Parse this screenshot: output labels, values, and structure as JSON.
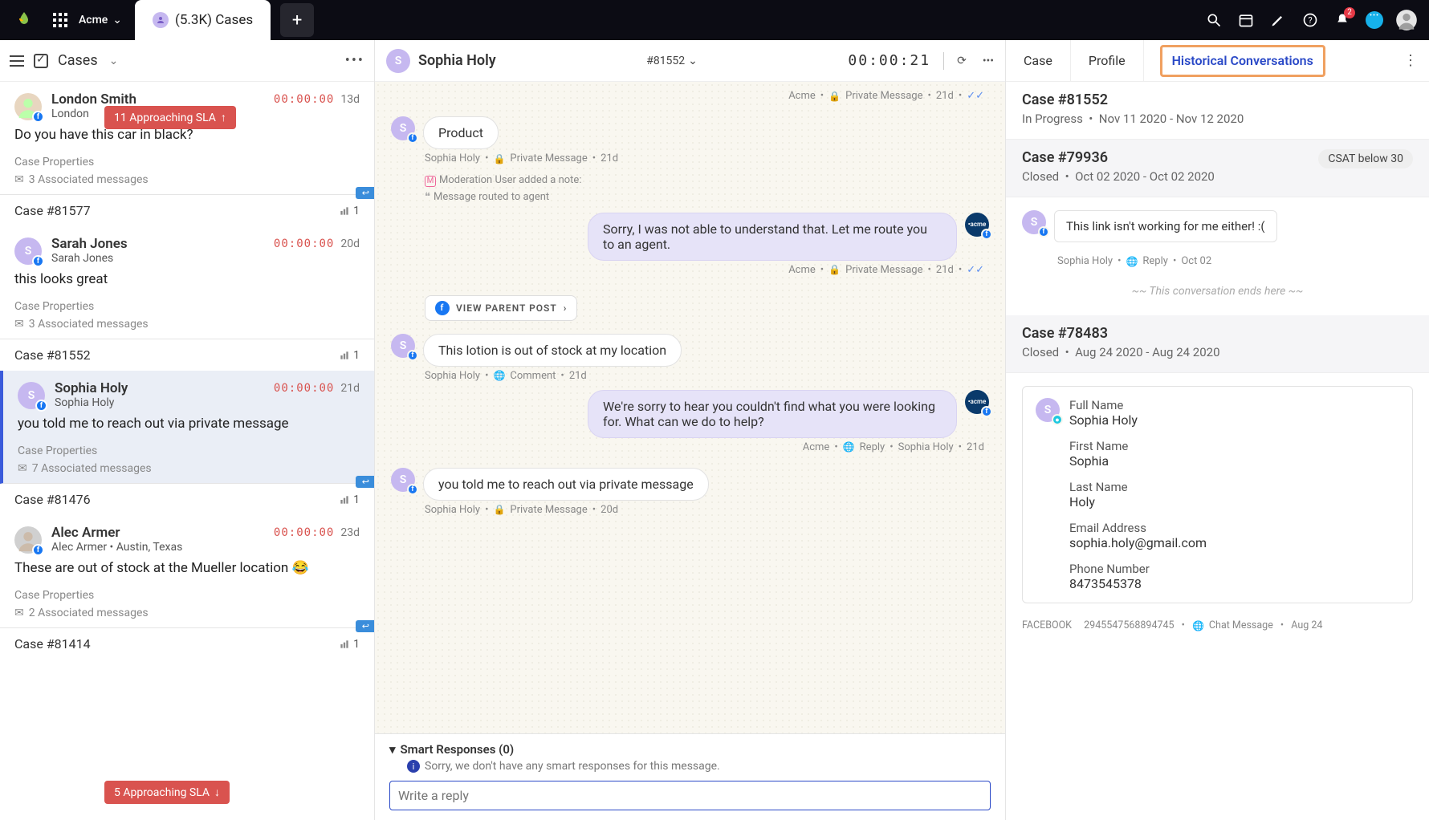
{
  "topbar": {
    "workspace": "Acme",
    "tab_label": "(5.3K) Cases"
  },
  "left": {
    "title": "Cases",
    "sla_top": "11 Approaching SLA",
    "sla_bottom": "5 Approaching SLA",
    "items": [
      {
        "name": "London Smith",
        "sub": "London",
        "timer": "00:00:00",
        "age": "13d",
        "text": "Do you have this car in black?",
        "cp": "Case Properties",
        "assoc": "3 Associated messages",
        "av_color": "#e8d6c0",
        "av_img": true
      }
    ],
    "sep1": {
      "label": "Case #81577",
      "count": "1",
      "reply": true
    },
    "item1": {
      "name": "Sarah Jones",
      "sub": "Sarah Jones",
      "timer": "00:00:00",
      "age": "20d",
      "text": "this looks great",
      "cp": "Case Properties",
      "assoc": "3 Associated messages",
      "initial": "S",
      "av_color": "#c6b8f0"
    },
    "sep2": {
      "label": "Case #81552",
      "count": "1"
    },
    "item2": {
      "name": "Sophia Holy",
      "sub": "Sophia Holy",
      "timer": "00:00:00",
      "age": "21d",
      "text": "you told me to reach out via private message",
      "cp": "Case Properties",
      "assoc": "7 Associated messages",
      "initial": "S",
      "av_color": "#c6b8f0",
      "active": true
    },
    "sep3": {
      "label": "Case #81476",
      "count": "1",
      "reply": true
    },
    "item3": {
      "name": "Alec Armer",
      "sub": "Alec Armer • Austin, Texas",
      "timer": "00:00:00",
      "age": "23d",
      "text": "These are out of stock at the Mueller location 😂",
      "cp": "Case Properties",
      "assoc": "2 Associated messages",
      "av_color": "#d0d0d0",
      "av_img": true
    },
    "sep4": {
      "label": "Case #81414",
      "count": "1",
      "reply": true
    }
  },
  "mid": {
    "name": "Sophia Holy",
    "case_no": "#81552",
    "timer": "00:00:21",
    "meta0": {
      "brand": "Acme",
      "kind": "Private Message",
      "age": "21d"
    },
    "m1": {
      "text": "Product",
      "meta": "Sophia Holy  •     Private Message  •  21d",
      "mod1": "Moderation User added a note:",
      "mod2": "Message routed to agent"
    },
    "m2": {
      "text": "Sorry, I was not able to understand that. Let me route you to an agent.",
      "meta_brand": "Acme",
      "meta_kind": "Private Message",
      "meta_age": "21d"
    },
    "vpp": "VIEW PARENT POST",
    "m3": {
      "text": "This lotion is out of stock at my location",
      "meta": "Sophia Holy  •     Comment  •  21d"
    },
    "m4": {
      "text": "We're sorry to hear you couldn't find what you were looking for. What can we do to help?",
      "meta_brand": "Acme",
      "meta_kind": "Reply",
      "meta_by": "Sophia Holy",
      "meta_age": "21d"
    },
    "m5": {
      "text": "you told me to reach out via private message",
      "meta": "Sophia Holy  •     Private Message  •  20d"
    },
    "smart_hdr": "Smart Responses (0)",
    "smart_msg": "Sorry, we don't have any smart responses for this message.",
    "reply_ph": "Write a reply"
  },
  "right": {
    "tabs": {
      "case": "Case",
      "profile": "Profile",
      "hist": "Historical Conversations"
    },
    "h1": {
      "title": "Case #81552",
      "status": "In Progress",
      "dates": "Nov 11 2020 - Nov 12 2020"
    },
    "h2": {
      "title": "Case #79936",
      "status": "Closed",
      "dates": "Oct 02 2020 - Oct 02 2020",
      "csat": "CSAT below 30",
      "msg": "This link isn't working for me either! :(",
      "meta_name": "Sophia Holy",
      "meta_kind": "Reply",
      "meta_date": "Oct 02",
      "end": "~~ This conversation ends here ~~"
    },
    "h3": {
      "title": "Case #78483",
      "status": "Closed",
      "dates": "Aug 24 2020 - Aug 24 2020"
    },
    "profile": {
      "full_l": "Full Name",
      "full_v": "Sophia Holy",
      "first_l": "First Name",
      "first_v": "Sophia",
      "last_l": "Last Name",
      "last_v": "Holy",
      "email_l": "Email Address",
      "email_v": "sophia.holy@gmail.com",
      "phone_l": "Phone Number",
      "phone_v": "8473545378"
    },
    "foot": {
      "src": "FACEBOOK",
      "id": "2945547568894745",
      "kind": "Chat Message",
      "date": "Aug 24"
    }
  }
}
